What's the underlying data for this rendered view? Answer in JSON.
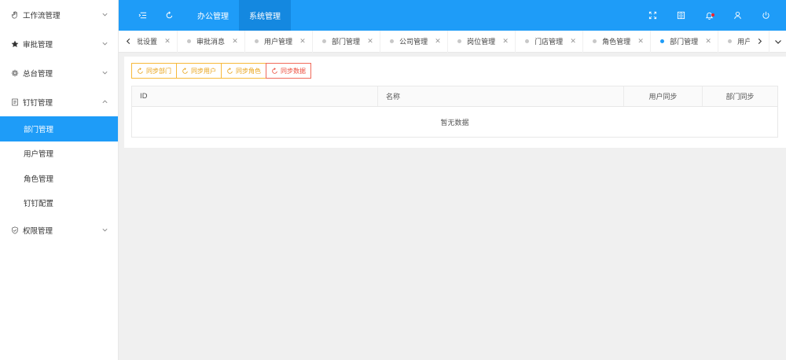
{
  "sidebar": {
    "groups": [
      {
        "label": "工作流管理",
        "icon": "hand-icon"
      },
      {
        "label": "审批管理",
        "icon": "star-icon"
      },
      {
        "label": "总台管理",
        "icon": "gear-icon"
      },
      {
        "label": "钉钉管理",
        "icon": "document-icon",
        "expanded": true,
        "items": [
          {
            "label": "部门管理",
            "active": true
          },
          {
            "label": "用户管理"
          },
          {
            "label": "角色管理"
          },
          {
            "label": "钉钉配置"
          }
        ]
      },
      {
        "label": "权限管理",
        "icon": "shield-icon"
      }
    ]
  },
  "header": {
    "nav": [
      {
        "label": "办公管理"
      },
      {
        "label": "系统管理",
        "active": true
      }
    ]
  },
  "tabs": [
    {
      "label": "审批设置"
    },
    {
      "label": "审批消息"
    },
    {
      "label": "用户管理"
    },
    {
      "label": "部门管理"
    },
    {
      "label": "公司管理"
    },
    {
      "label": "岗位管理"
    },
    {
      "label": "门店管理"
    },
    {
      "label": "角色管理"
    },
    {
      "label": "部门管理",
      "active": true
    },
    {
      "label": "用户管理"
    }
  ],
  "toolbar": {
    "buttons": [
      {
        "label": "同步部门"
      },
      {
        "label": "同步用户"
      },
      {
        "label": "同步角色"
      },
      {
        "label": "同步数据"
      }
    ]
  },
  "table": {
    "columns": [
      "ID",
      "名称",
      "用户同步",
      "部门同步"
    ],
    "empty_text": "暂无数据"
  },
  "colors": {
    "primary": "#1e9cf8",
    "warning": "#e8a318",
    "danger": "#ec4d3d"
  }
}
